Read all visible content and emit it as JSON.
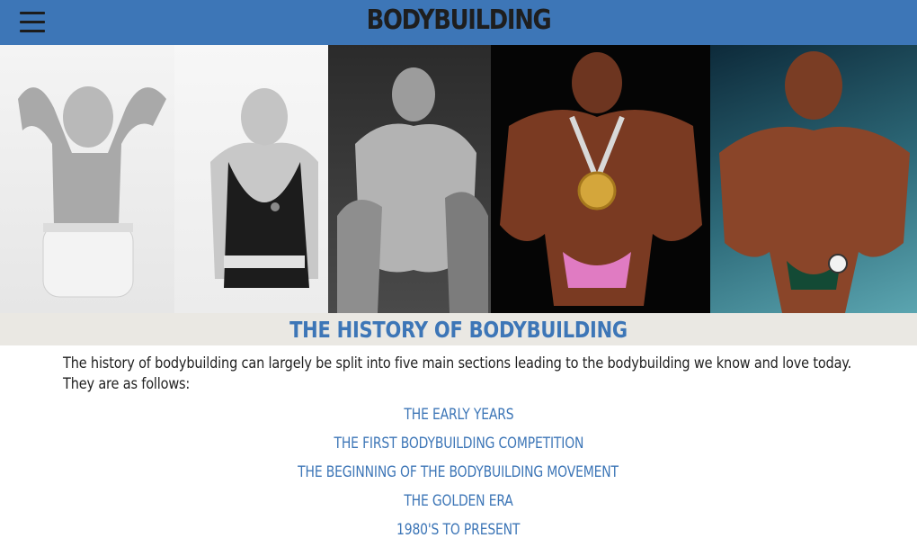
{
  "header": {
    "brand": "BODYBUILDING",
    "menu_icon": "hamburger-menu-icon",
    "background": "#3d76b7"
  },
  "gallery": {
    "photos": [
      {
        "name": "early-era-bodybuilder-flexing-photo"
      },
      {
        "name": "strongman-in-singlet-photo"
      },
      {
        "name": "golden-era-bodybuilder-pose-photo"
      },
      {
        "name": "bodybuilder-with-medal-photo"
      },
      {
        "name": "modern-bodybuilder-stage-photo"
      }
    ]
  },
  "main": {
    "title": "THE HISTORY OF BODYBUILDING",
    "intro": "The history of bodybuilding can largely be split into five main sections leading to the bodybuilding we know and love today. They are as follows:",
    "sections": [
      "THE EARLY YEARS",
      "THE FIRST BODYBUILDING COMPETITION",
      "THE BEGINNING OF THE BODYBUILDING MOVEMENT",
      "THE GOLDEN ERA",
      "1980'S TO PRESENT"
    ]
  },
  "colors": {
    "accent": "#3d76b7",
    "title_band": "#eae8e3",
    "body_text": "#1f1f1f"
  }
}
